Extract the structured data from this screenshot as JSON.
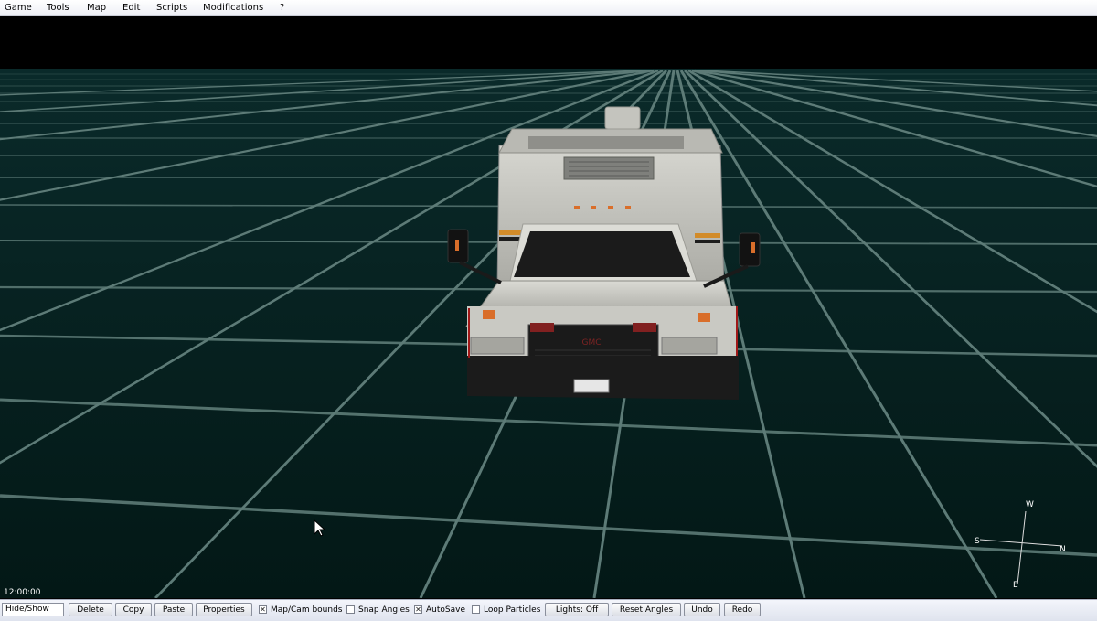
{
  "menu": [
    {
      "label": "Game"
    },
    {
      "label": "Tools"
    },
    {
      "label": "Map"
    },
    {
      "label": "Edit"
    },
    {
      "label": "Scripts"
    },
    {
      "label": "Modifications"
    },
    {
      "label": "?"
    }
  ],
  "viewport": {
    "time": "12:00:00",
    "grid_color": "#4f6d6a",
    "ground_color": "#031817",
    "compass": {
      "north": "N",
      "south": "S",
      "east": "E",
      "west": "W"
    }
  },
  "toolbar": {
    "hide_show": "Hide/Show",
    "delete": "Delete",
    "copy": "Copy",
    "paste": "Paste",
    "properties": "Properties",
    "map_cam_bounds": {
      "label": "Map/Cam bounds",
      "checked": true
    },
    "snap_angles": {
      "label": "Snap Angles",
      "checked": false
    },
    "autosave": {
      "label": "AutoSave",
      "checked": true
    },
    "loop_particles": {
      "label": "Loop Particles",
      "checked": false
    },
    "lights": "Lights: Off",
    "reset_angles": "Reset Angles",
    "undo": "Undo",
    "redo": "Redo"
  },
  "vehicle_badge": "GMC"
}
